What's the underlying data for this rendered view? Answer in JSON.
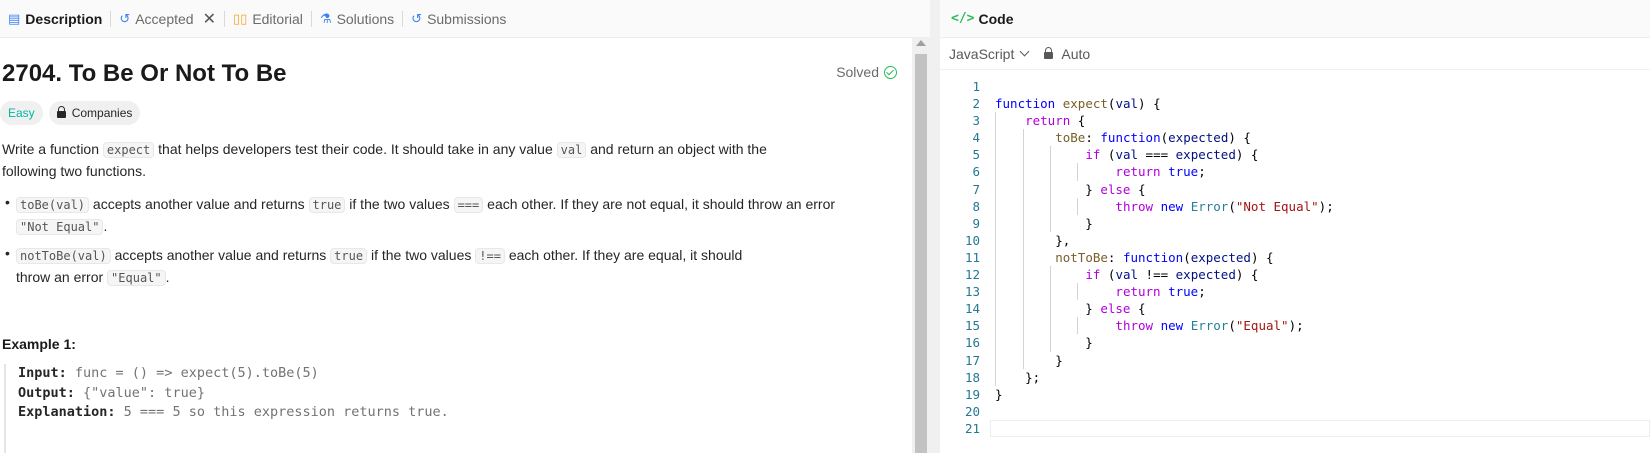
{
  "tabs": {
    "description": "Description",
    "accepted": "Accepted",
    "editorial": "Editorial",
    "solutions": "Solutions",
    "submissions": "Submissions"
  },
  "problem": {
    "title": "2704. To Be Or Not To Be",
    "status": "Solved",
    "difficulty": "Easy",
    "companies": "Companies",
    "intro_1": "Write a function ",
    "intro_code_1": "expect",
    "intro_2": " that helps developers test their code. It should take in any value ",
    "intro_code_2": "val",
    "intro_3": " and return an object with the following two functions.",
    "b1_code_1": "toBe(val)",
    "b1_t1": " accepts another value and returns ",
    "b1_code_2": "true",
    "b1_t2": " if the two values ",
    "b1_code_3": "===",
    "b1_t3": " each other. If they are not equal, it should throw an error ",
    "b1_code_4": "\"Not Equal\"",
    "b1_t4": ".",
    "b2_code_1": "notToBe(val)",
    "b2_t1": " accepts another value and returns ",
    "b2_code_2": "true",
    "b2_t2": " if the two values ",
    "b2_code_3": "!==",
    "b2_t3": " each other. If they are equal, it should throw an error ",
    "b2_code_4": "\"Equal\"",
    "b2_t4": ".",
    "example_title": "Example 1:",
    "example": {
      "input_label": "Input:",
      "input_value": " func = () => expect(5).toBe(5)",
      "output_label": "Output:",
      "output_value": " {\"value\": true}",
      "explanation_label": "Explanation:",
      "explanation_value": " 5 === 5 so this expression returns true."
    }
  },
  "editor": {
    "header": "Code",
    "language": "JavaScript",
    "mode": "Auto",
    "line_numbers": [
      "1",
      "2",
      "3",
      "4",
      "5",
      "6",
      "7",
      "8",
      "9",
      "10",
      "11",
      "12",
      "13",
      "14",
      "15",
      "16",
      "17",
      "18",
      "19",
      "20",
      "21"
    ]
  }
}
